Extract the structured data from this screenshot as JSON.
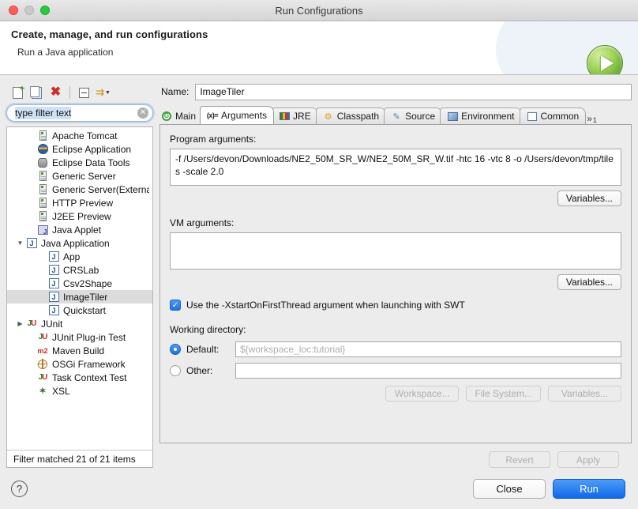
{
  "window": {
    "title": "Run Configurations",
    "traffic": {
      "close": "close-window",
      "minimize": "minimize-window",
      "zoom": "zoom-window"
    }
  },
  "header": {
    "title": "Create, manage, and run configurations",
    "subtitle": "Run a Java application",
    "badge_icon": "run-play-icon"
  },
  "toolbar": {
    "new_label": "new-launch-configuration",
    "duplicate_label": "duplicate-launch-configuration",
    "delete_label": "delete-launch-configuration",
    "collapse_label": "collapse-all",
    "filter_label": "filter-launch-configurations"
  },
  "filter": {
    "value": "type filter text",
    "clear_glyph": "✕"
  },
  "tree": {
    "status": "Filter matched 21 of 21 items",
    "items": [
      {
        "label": "Apache Tomcat",
        "icon": "server-icon",
        "indent": 1,
        "twisty": "",
        "selected": false
      },
      {
        "label": "Eclipse Application",
        "icon": "eclipse-icon",
        "indent": 1,
        "twisty": "",
        "selected": false
      },
      {
        "label": "Eclipse Data Tools",
        "icon": "database-icon",
        "indent": 1,
        "twisty": "",
        "selected": false
      },
      {
        "label": "Generic Server",
        "icon": "server-icon",
        "indent": 1,
        "twisty": "",
        "selected": false
      },
      {
        "label": "Generic Server(External La",
        "icon": "server-icon",
        "indent": 1,
        "twisty": "",
        "selected": false
      },
      {
        "label": "HTTP Preview",
        "icon": "server-icon",
        "indent": 1,
        "twisty": "",
        "selected": false
      },
      {
        "label": "J2EE Preview",
        "icon": "server-icon",
        "indent": 1,
        "twisty": "",
        "selected": false
      },
      {
        "label": "Java Applet",
        "icon": "java-applet-icon",
        "indent": 1,
        "twisty": "",
        "selected": false
      },
      {
        "label": "Java Application",
        "icon": "java-icon",
        "indent": 0,
        "twisty": "▼",
        "selected": false
      },
      {
        "label": "App",
        "icon": "java-icon",
        "indent": 2,
        "twisty": "",
        "selected": false
      },
      {
        "label": "CRSLab",
        "icon": "java-icon",
        "indent": 2,
        "twisty": "",
        "selected": false
      },
      {
        "label": "Csv2Shape",
        "icon": "java-icon",
        "indent": 2,
        "twisty": "",
        "selected": false
      },
      {
        "label": "ImageTiler",
        "icon": "java-icon",
        "indent": 2,
        "twisty": "",
        "selected": true
      },
      {
        "label": "Quickstart",
        "icon": "java-icon",
        "indent": 2,
        "twisty": "",
        "selected": false
      },
      {
        "label": "JUnit",
        "icon": "junit-icon",
        "indent": 0,
        "twisty": "▶",
        "selected": false
      },
      {
        "label": "JUnit Plug-in Test",
        "icon": "junit-plugin-icon",
        "indent": 1,
        "twisty": "",
        "selected": false
      },
      {
        "label": "Maven Build",
        "icon": "maven-icon",
        "indent": 1,
        "twisty": "",
        "selected": false
      },
      {
        "label": "OSGi Framework",
        "icon": "osgi-icon",
        "indent": 1,
        "twisty": "",
        "selected": false
      },
      {
        "label": "Task Context Test",
        "icon": "task-context-icon",
        "indent": 1,
        "twisty": "",
        "selected": false
      },
      {
        "label": "XSL",
        "icon": "xsl-icon",
        "indent": 1,
        "twisty": "",
        "selected": false
      }
    ]
  },
  "name_field": {
    "label": "Name:",
    "value": "ImageTiler"
  },
  "tabs": [
    {
      "label": "Main",
      "icon": "main-tab-icon",
      "active": false
    },
    {
      "label": "Arguments",
      "icon": "arguments-tab-icon",
      "active": true
    },
    {
      "label": "JRE",
      "icon": "jre-tab-icon",
      "active": false
    },
    {
      "label": "Classpath",
      "icon": "classpath-tab-icon",
      "active": false
    },
    {
      "label": "Source",
      "icon": "source-tab-icon",
      "active": false
    },
    {
      "label": "Environment",
      "icon": "environment-tab-icon",
      "active": false
    },
    {
      "label": "Common",
      "icon": "common-tab-icon",
      "active": false
    }
  ],
  "tab_overflow": {
    "glyph": "»",
    "count": "1"
  },
  "arguments_tab": {
    "program_args_label": "Program arguments:",
    "program_args_value": "-f /Users/devon/Downloads/NE2_50M_SR_W/NE2_50M_SR_W.tif  -htc 16 -vtc 8 -o /Users/devon/tmp/tiles -scale 2.0",
    "program_variables_button": "Variables...",
    "vm_args_label": "VM arguments:",
    "vm_args_value": "",
    "vm_variables_button": "Variables...",
    "swt_checkbox_label": "Use the -XstartOnFirstThread argument when launching with SWT",
    "swt_checkbox_checked": true,
    "swt_check_glyph": "✓",
    "working_dir_label": "Working directory:",
    "default_radio_label": "Default:",
    "default_radio_selected": true,
    "default_value": "${workspace_loc:tutorial}",
    "other_radio_label": "Other:",
    "other_radio_selected": false,
    "other_value": "",
    "workspace_button": "Workspace...",
    "file_system_button": "File System...",
    "variables_button": "Variables..."
  },
  "footer": {
    "revert_button": "Revert",
    "apply_button": "Apply",
    "help_glyph": "?",
    "close_button": "Close",
    "run_button": "Run"
  },
  "colors": {
    "accent_blue": "#1168e8",
    "run_green": "#63a832",
    "selection_gray": "#dcdcdc",
    "delete_red": "#cf2b2b"
  }
}
